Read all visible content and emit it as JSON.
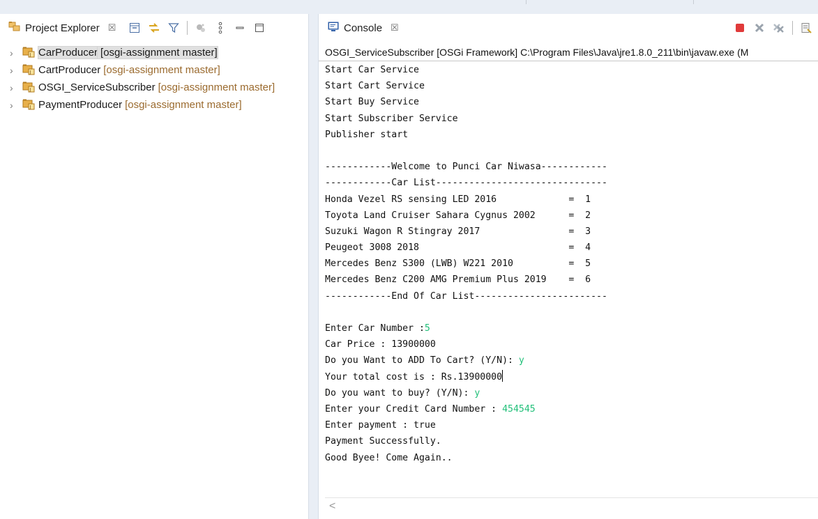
{
  "project_explorer": {
    "tab_label": "Project Explorer",
    "close_glyph": "☒",
    "toolbar_icons": [
      "collapse-all-icon",
      "link-with-editor-icon",
      "filter-icon",
      "focus-on-active-task-icon",
      "view-menu-icon",
      "minimize-icon",
      "maximize-icon"
    ],
    "projects": [
      {
        "name": "CarProducer",
        "repo": "[osgi-assignment master]",
        "selected": true
      },
      {
        "name": "CartProducer",
        "repo": "[osgi-assignment master]",
        "selected": false
      },
      {
        "name": "OSGI_ServiceSubscriber",
        "repo": "[osgi-assignment master]",
        "selected": false
      },
      {
        "name": "PaymentProducer",
        "repo": "[osgi-assignment master]",
        "selected": false
      }
    ]
  },
  "console": {
    "tab_label": "Console",
    "close_glyph": "☒",
    "toolbar_icons": [
      "terminate-icon",
      "remove-launch-icon",
      "remove-all-terminated-icon",
      "clear-console-icon"
    ],
    "launch_title": "OSGI_ServiceSubscriber [OSGi Framework] C:\\Program Files\\Java\\jre1.8.0_211\\bin\\javaw.exe (M",
    "lines": [
      {
        "text": "Start Car Service"
      },
      {
        "text": "Start Cart Service"
      },
      {
        "text": "Start Buy Service"
      },
      {
        "text": "Start Subscriber Service"
      },
      {
        "text": "Publisher start"
      },
      {
        "text": ""
      },
      {
        "text": "------------Welcome to Punci Car Niwasa------------"
      },
      {
        "text": "------------Car List-------------------------------"
      },
      {
        "text": "Honda Vezel RS sensing LED 2016             =  1"
      },
      {
        "text": "Toyota Land Cruiser Sahara Cygnus 2002      =  2"
      },
      {
        "text": "Suzuki Wagon R Stingray 2017                =  3"
      },
      {
        "text": "Peugeot 3008 2018                           =  4"
      },
      {
        "text": "Mercedes Benz S300 (LWB) W221 2010          =  5"
      },
      {
        "text": "Mercedes Benz C200 AMG Premium Plus 2019    =  6"
      },
      {
        "text": "------------End Of Car List------------------------"
      },
      {
        "text": ""
      },
      {
        "text": "Enter Car Number :",
        "input": "5"
      },
      {
        "text": "Car Price : 13900000"
      },
      {
        "text": "Do you Want to ADD To Cart? (Y/N): ",
        "input": "y"
      },
      {
        "text": "Your total cost is : Rs.13900000",
        "caret": true
      },
      {
        "text": "Do you want to buy? (Y/N): ",
        "input": "y"
      },
      {
        "text": "Enter your Credit Card Number : ",
        "input": "454545"
      },
      {
        "text": "Enter payment : true"
      },
      {
        "text": "Payment Successfully."
      },
      {
        "text": "Good Byee! Come Again.."
      }
    ],
    "scroll_left_glyph": "<"
  },
  "colors": {
    "user_input": "#22c07a",
    "repo_decoration": "#9b6b2f",
    "terminate": "#e03a3a"
  }
}
